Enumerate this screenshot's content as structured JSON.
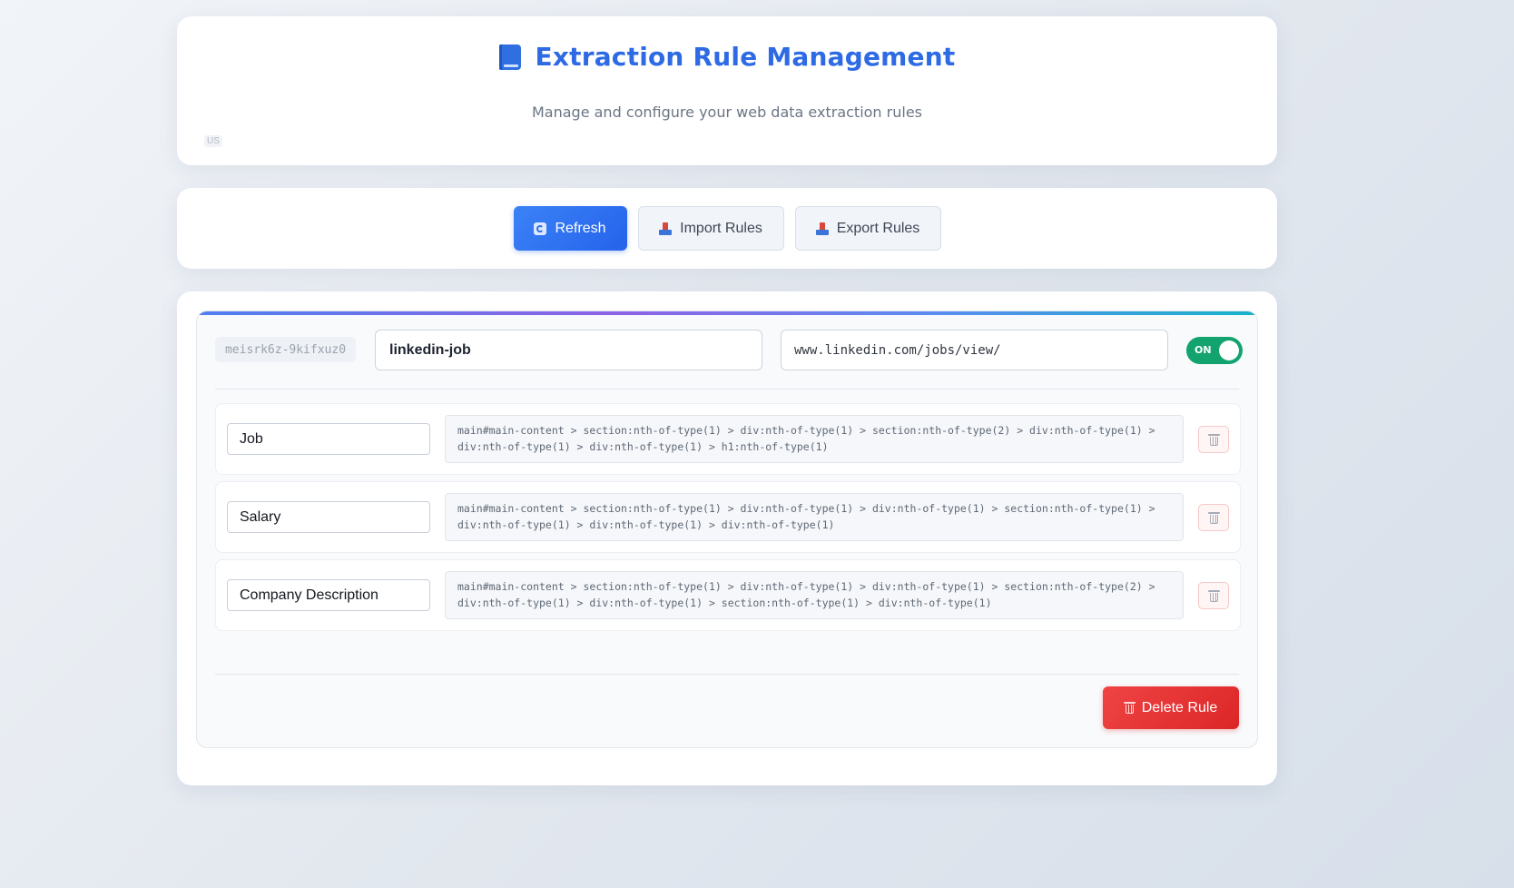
{
  "header": {
    "title": "Extraction Rule Management",
    "subtitle": "Manage and configure your web data extraction rules",
    "lang_badge": "US",
    "title_icon": "book-icon"
  },
  "toolbar": {
    "refresh_label": "Refresh",
    "import_label": "Import Rules",
    "export_label": "Export Rules"
  },
  "rule": {
    "id": "meisrk6z-9kifxuz0",
    "name": "linkedin-job",
    "url": "www.linkedin.com/jobs/view/",
    "enabled": true,
    "toggle_label": "ON",
    "fields": [
      {
        "name": "Job",
        "selector": "main#main-content > section:nth-of-type(1) > div:nth-of-type(1) > section:nth-of-type(2) > div:nth-of-type(1) > div:nth-of-type(1) > div:nth-of-type(1) > h1:nth-of-type(1)"
      },
      {
        "name": "Salary",
        "selector": "main#main-content > section:nth-of-type(1) > div:nth-of-type(1) > div:nth-of-type(1) > section:nth-of-type(1) > div:nth-of-type(1) > div:nth-of-type(1) > div:nth-of-type(1)"
      },
      {
        "name": "Company Description",
        "selector": "main#main-content > section:nth-of-type(1) > div:nth-of-type(1) > div:nth-of-type(1) > section:nth-of-type(2) > div:nth-of-type(1) > div:nth-of-type(1) > section:nth-of-type(1) > div:nth-of-type(1)"
      }
    ],
    "delete_label": "Delete Rule"
  },
  "colors": {
    "accent": "#2d6ae3",
    "primary_button": "#2563eb",
    "toggle_on": "#12a36f",
    "danger": "#dc2626"
  }
}
